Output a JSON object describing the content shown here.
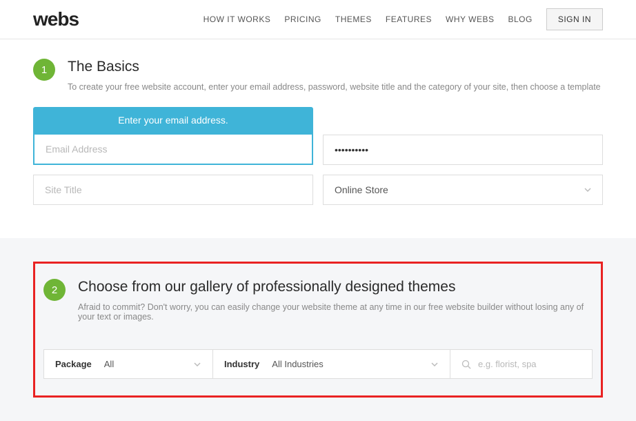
{
  "header": {
    "logo": "webs",
    "nav": [
      "HOW IT WORKS",
      "PRICING",
      "THEMES",
      "FEATURES",
      "WHY WEBS",
      "BLOG"
    ],
    "signin": "SIGN IN"
  },
  "step1": {
    "num": "1",
    "title": "The Basics",
    "desc": "To create your free website account, enter your email address, password, website title and the category of your site, then choose a template",
    "tooltip": "Enter your email address.",
    "email_placeholder": "Email Address",
    "email_value": "",
    "password_value": "••••••••••",
    "title_placeholder": "Site Title",
    "title_value": "",
    "category_value": "Online Store"
  },
  "step2": {
    "num": "2",
    "title": "Choose from our gallery of professionally designed themes",
    "desc": "Afraid to commit? Don't worry, you can easily change your website theme at any time in our free website builder without losing any of your text or images.",
    "package_label": "Package",
    "package_value": "All",
    "industry_label": "Industry",
    "industry_value": "All Industries",
    "search_placeholder": "e.g. florist, spa",
    "search_value": ""
  }
}
